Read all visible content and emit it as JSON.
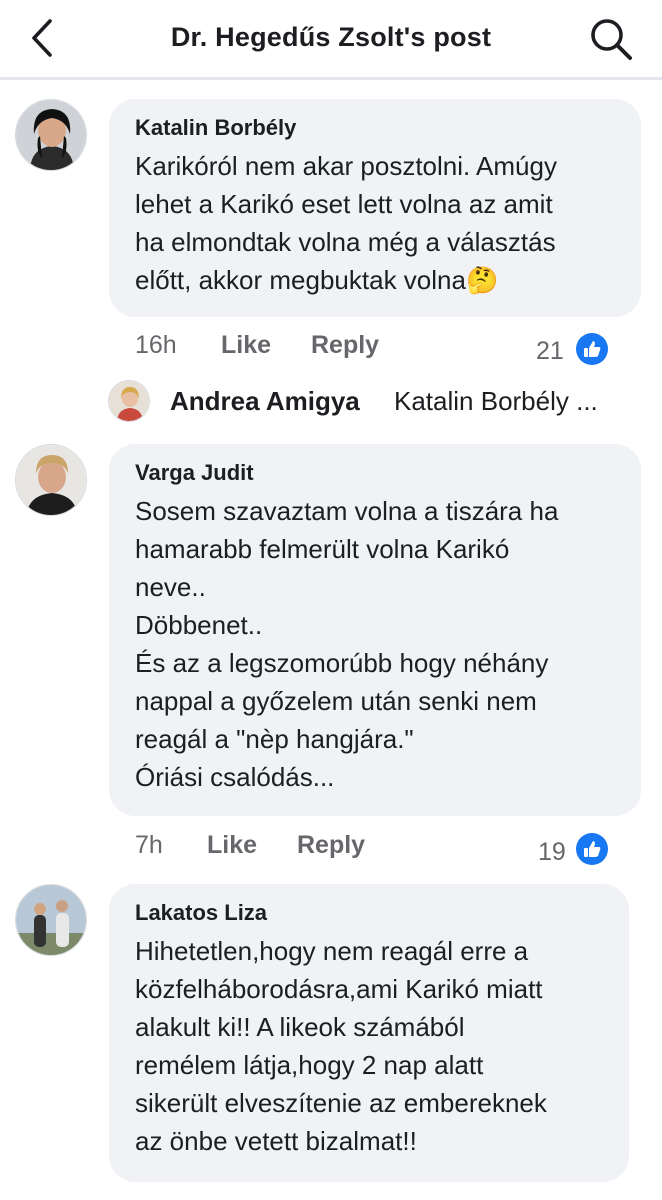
{
  "header": {
    "title": "Dr. Hegedűs Zsolt's post"
  },
  "comments": [
    {
      "author": "Katalin Borbély",
      "text": "Karikóról nem akar posztolni. Amúgy\nlehet a Karikó eset lett volna az amit\nha elmondtak volna még a választás\nelőtt, akkor megbuktak volna🤔",
      "time": "16h",
      "like": "Like",
      "reply": "Reply",
      "reactions": "21"
    },
    {
      "author": "Varga Judit",
      "text": "Sosem szavaztam volna a tiszára ha\nhamarabb felmerült volna Karikó\nneve..\nDöbbenet..\nÉs az a legszomorúbb hogy néhány\nnappal a győzelem után senki nem\nreagál a \"nèp hangjára.\"\nÓriási csalódás...",
      "time": "7h",
      "like": "Like",
      "reply": "Reply",
      "reactions": "19"
    },
    {
      "author": "Lakatos Liza",
      "text": "Hihetetlen,hogy nem reagál erre a\nközfelháborodásra,ami Karikó miatt\nalakult ki!! A likeok számából\nremélem látja,hogy 2 nap alatt\nsikerült elveszítenie az embereknek\naz önbe vetett bizalmat!!"
    }
  ],
  "reply_preview": {
    "author": "Andrea Amigya",
    "snippet": "Katalin Borbély ..."
  },
  "colors": {
    "accent": "#1877f2",
    "bubble": "#f0f2f5",
    "meta": "#65676b"
  },
  "icons": {
    "back": "back-arrow-icon",
    "search": "search-icon",
    "like": "thumbs-up-icon"
  }
}
